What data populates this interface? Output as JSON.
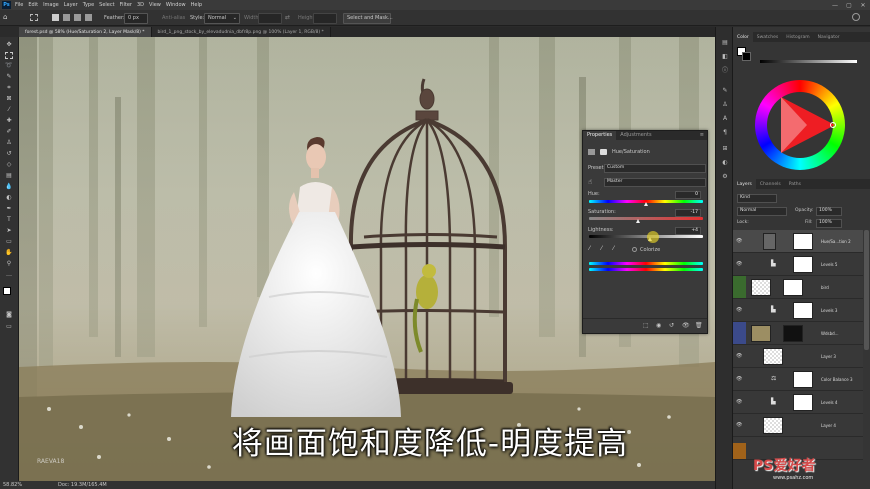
{
  "app": {
    "logo": "Ps"
  },
  "menu": [
    "File",
    "Edit",
    "Image",
    "Layer",
    "Type",
    "Select",
    "Filter",
    "3D",
    "View",
    "Window",
    "Help"
  ],
  "window_controls": [
    "—",
    "▢",
    "✕"
  ],
  "options_bar": {
    "feather_label": "Feather:",
    "feather_value": "0 px",
    "antialias_label": "Anti-alias",
    "style_label": "Style:",
    "style_value": "Normal",
    "width_label": "Width:",
    "height_label": "Height:",
    "select_mask_label": "Select and Mask..."
  },
  "tabs": [
    {
      "label": "forest.psd @ 58% (Hue/Saturation 2, Layer Mask/8) *",
      "active": true
    },
    {
      "label": "bird_1_png_stock_by_elevadudnia_dbfr8p.png @ 100% (Layer 1, RGB/8) *",
      "active": false
    }
  ],
  "status": {
    "zoom": "58.82%",
    "doc": "Doc: 19.3M/165.4M"
  },
  "watermark": {
    "left": "RAEVA18",
    "right_logo": "PS爱好者",
    "right_url": "www.psahz.com"
  },
  "subtitle": "将画面饱和度降低-明度提高",
  "color_panel": {
    "tabs": [
      "Color",
      "Swatches",
      "Histogram",
      "Navigator"
    ],
    "colors": {
      "hue_ring": "conic",
      "triangle": "#ee1d23"
    }
  },
  "properties": {
    "tabs": [
      "Properties",
      "Adjustments"
    ],
    "adjustment_title": "Hue/Saturation",
    "preset_label": "Preset:",
    "preset_value": "Custom",
    "channel_value": "Master",
    "hue_label": "Hue:",
    "hue_value": "0",
    "saturation_label": "Saturation:",
    "saturation_value": "-17",
    "lightness_label": "Lightness:",
    "lightness_value": "+4",
    "colorize_label": "Colorize"
  },
  "layers_panel": {
    "tabs": [
      "Layers",
      "Channels",
      "Paths"
    ],
    "filter_kind": "Kind",
    "blend_mode": "Normal",
    "opacity_label": "Opacity:",
    "opacity_value": "100%",
    "lock_label": "Lock:",
    "fill_label": "Fill:",
    "fill_value": "100%",
    "layers": [
      {
        "name": "Hue/Sa...tion 2",
        "adj": "▦",
        "selected": true
      },
      {
        "name": "Levels 5",
        "adj": "▙"
      },
      {
        "name": "bird",
        "adj": ""
      },
      {
        "name": "Levels 3",
        "adj": "▙"
      },
      {
        "name": "Wdsbd...",
        "adj": ""
      },
      {
        "name": "Layer 3",
        "adj": ""
      },
      {
        "name": "Color Balance 3",
        "adj": "⚖"
      },
      {
        "name": "Levels 4",
        "adj": "▙"
      },
      {
        "name": "Layer 4",
        "adj": ""
      }
    ]
  }
}
